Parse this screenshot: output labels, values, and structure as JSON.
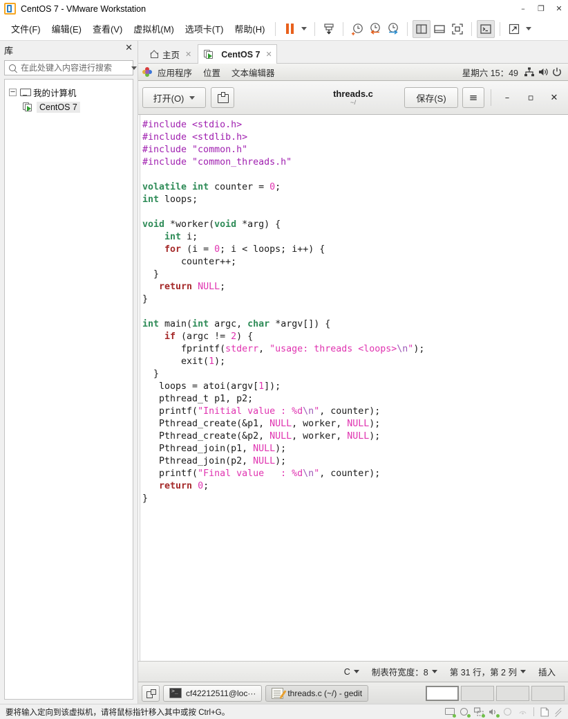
{
  "window": {
    "title": "CentOS 7  - VMware Workstation",
    "minimize": "–",
    "maximize": "❐",
    "close": "✕"
  },
  "menubar": [
    {
      "label": "文件(F)",
      "name": "menu-file"
    },
    {
      "label": "编辑(E)",
      "name": "menu-edit"
    },
    {
      "label": "查看(V)",
      "name": "menu-view"
    },
    {
      "label": "虚拟机(M)",
      "name": "menu-vm"
    },
    {
      "label": "选项卡(T)",
      "name": "menu-tabs"
    },
    {
      "label": "帮助(H)",
      "name": "menu-help"
    }
  ],
  "sidebar": {
    "title": "库",
    "close_label": "✕",
    "search": {
      "placeholder": "在此处键入内容进行搜索",
      "value": ""
    },
    "tree": [
      {
        "label": "我的计算机",
        "expander": "─",
        "icon": "monitor-icon",
        "level": 0,
        "selected": false
      },
      {
        "label": "CentOS 7",
        "icon": "vm-icon",
        "level": 1,
        "selected": true
      }
    ]
  },
  "tabs": [
    {
      "label": "主页",
      "icon": "home-icon",
      "active": false,
      "close": "✕"
    },
    {
      "label": "CentOS 7",
      "icon": "vm-icon",
      "active": true,
      "close": "✕"
    }
  ],
  "gnome_panel": {
    "items": [
      {
        "label": "应用程序",
        "name": "gnome-applications"
      },
      {
        "label": "位置",
        "name": "gnome-places"
      },
      {
        "label": "文本编辑器",
        "name": "gnome-active-app"
      }
    ],
    "clock": "星期六 15：49"
  },
  "gedit": {
    "open_label": "打开(O)",
    "save_label": "保存(S)",
    "menu_label": "≡",
    "title": "threads.c",
    "subtitle": "~/",
    "minimize": "–",
    "maximize": "▫",
    "close": "✕",
    "status": {
      "language": "C",
      "tab_width": "制表符宽度：8",
      "position": "第 31 行，第 2 列",
      "insert_mode": "插入"
    }
  },
  "code": {
    "language": "c",
    "filename": "threads.c",
    "lines": [
      "#include <stdio.h>",
      "#include <stdlib.h>",
      "#include \"common.h\"",
      "#include \"common_threads.h\"",
      "",
      "volatile int counter = 0;",
      "int loops;",
      "",
      "void *worker(void *arg) {",
      "    int i;",
      "    for (i = 0; i < loops; i++) {",
      "       counter++;",
      "  }",
      "   return NULL;",
      "}",
      "",
      "int main(int argc, char *argv[]) {",
      "    if (argc != 2) {",
      "       fprintf(stderr, \"usage: threads <loops>\\n\");",
      "       exit(1);",
      "  }",
      "   loops = atoi(argv[1]);",
      "   pthread_t p1, p2;",
      "   printf(\"Initial value : %d\\n\", counter);",
      "   Pthread_create(&p1, NULL, worker, NULL);",
      "   Pthread_create(&p2, NULL, worker, NULL);",
      "   Pthread_join(p1, NULL);",
      "   Pthread_join(p2, NULL);",
      "   printf(\"Final value   : %d\\n\", counter);",
      "   return 0;",
      "}"
    ]
  },
  "taskbar": {
    "windows": [
      {
        "label": "cf42212511@loc···",
        "icon": "terminal-icon",
        "active": false
      },
      {
        "label": "threads.c (~/) - gedit",
        "icon": "gedit-icon",
        "active": true
      }
    ],
    "workspaces": [
      {
        "active": true
      },
      {
        "active": false
      },
      {
        "active": false
      },
      {
        "active": false
      }
    ]
  },
  "vm_statusbar": {
    "message": "要将输入定向到该虚拟机，请将鼠标指针移入其中或按 Ctrl+G。"
  },
  "colors": {
    "accent_orange": "#e8601c",
    "preprocessor": "#a020b0",
    "type_keyword": "#2e8b57",
    "control_keyword": "#a52a2a",
    "string": "#e033b0",
    "number": "#e033b0",
    "ok_green": "#5cb82e"
  }
}
